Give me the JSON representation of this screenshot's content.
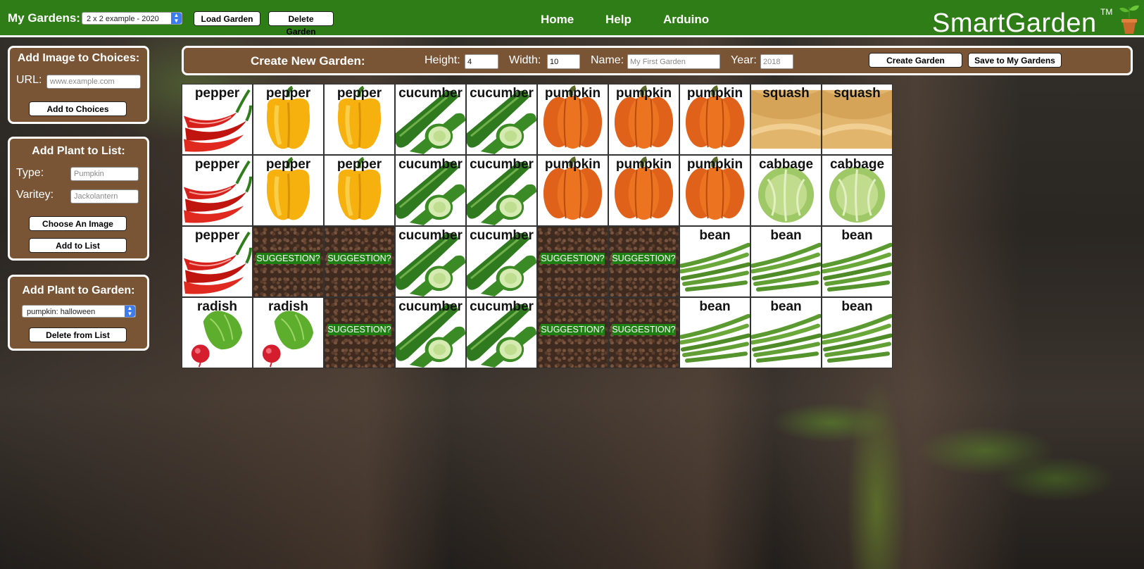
{
  "header": {
    "my_gardens_label": "My Gardens:",
    "selected_garden": "2 x 2 example - 2020",
    "load_garden": "Load Garden",
    "delete_garden": "Delete Garden",
    "nav": [
      "Home",
      "Help",
      "Arduino"
    ],
    "brand": "SmartGarden",
    "tm": "TM"
  },
  "add_image": {
    "title": "Add Image to Choices:",
    "url_label": "URL:",
    "url_placeholder": "www.example.com",
    "button": "Add to Choices"
  },
  "add_plant_list": {
    "title": "Add Plant to List:",
    "type_label": "Type:",
    "type_placeholder": "Pumpkin",
    "variety_label": "Varitey:",
    "variety_placeholder": "Jackolantern",
    "choose_image": "Choose An Image",
    "add_to_list": "Add to List"
  },
  "add_plant_garden": {
    "title": "Add Plant to Garden:",
    "selected": "pumpkin: halloween",
    "delete": "Delete from List"
  },
  "create": {
    "title": "Create New Garden:",
    "height_label": "Height:",
    "height_value": "4",
    "width_label": "Width:",
    "width_value": "10",
    "name_label": "Name:",
    "name_placeholder": "My First Garden",
    "year_label": "Year:",
    "year_placeholder": "2018",
    "create_button": "Create Garden",
    "save_button": "Save to My Gardens"
  },
  "suggestion_label": "SUGGESTION?",
  "grid": [
    [
      "pepper",
      "pepper",
      "pepper",
      "cucumber",
      "cucumber",
      "pumpkin",
      "pumpkin",
      "pumpkin",
      "squash",
      "squash"
    ],
    [
      "pepper",
      "pepper",
      "pepper",
      "cucumber",
      "cucumber",
      "pumpkin",
      "pumpkin",
      "pumpkin",
      "cabbage",
      "cabbage"
    ],
    [
      "pepper",
      "",
      "",
      "cucumber",
      "cucumber",
      "",
      "",
      "bean",
      "bean",
      "bean"
    ],
    [
      "radish",
      "radish",
      "",
      "cucumber",
      "cucumber",
      "",
      "",
      "bean",
      "bean",
      "bean"
    ]
  ],
  "grid_art": [
    [
      "chili",
      "bell",
      "bell",
      "cucumber",
      "cucumber",
      "pumpkin",
      "pumpkin",
      "pumpkin",
      "squash",
      "squash"
    ],
    [
      "chili",
      "bell",
      "bell",
      "cucumber",
      "cucumber",
      "pumpkin",
      "pumpkin",
      "pumpkin",
      "cabbage",
      "cabbage"
    ],
    [
      "chili",
      "soil",
      "soil",
      "cucumber",
      "cucumber",
      "soil",
      "soil",
      "bean",
      "bean",
      "bean"
    ],
    [
      "radish",
      "radish",
      "soil",
      "cucumber",
      "cucumber",
      "soil",
      "soil",
      "bean",
      "bean",
      "bean"
    ]
  ]
}
